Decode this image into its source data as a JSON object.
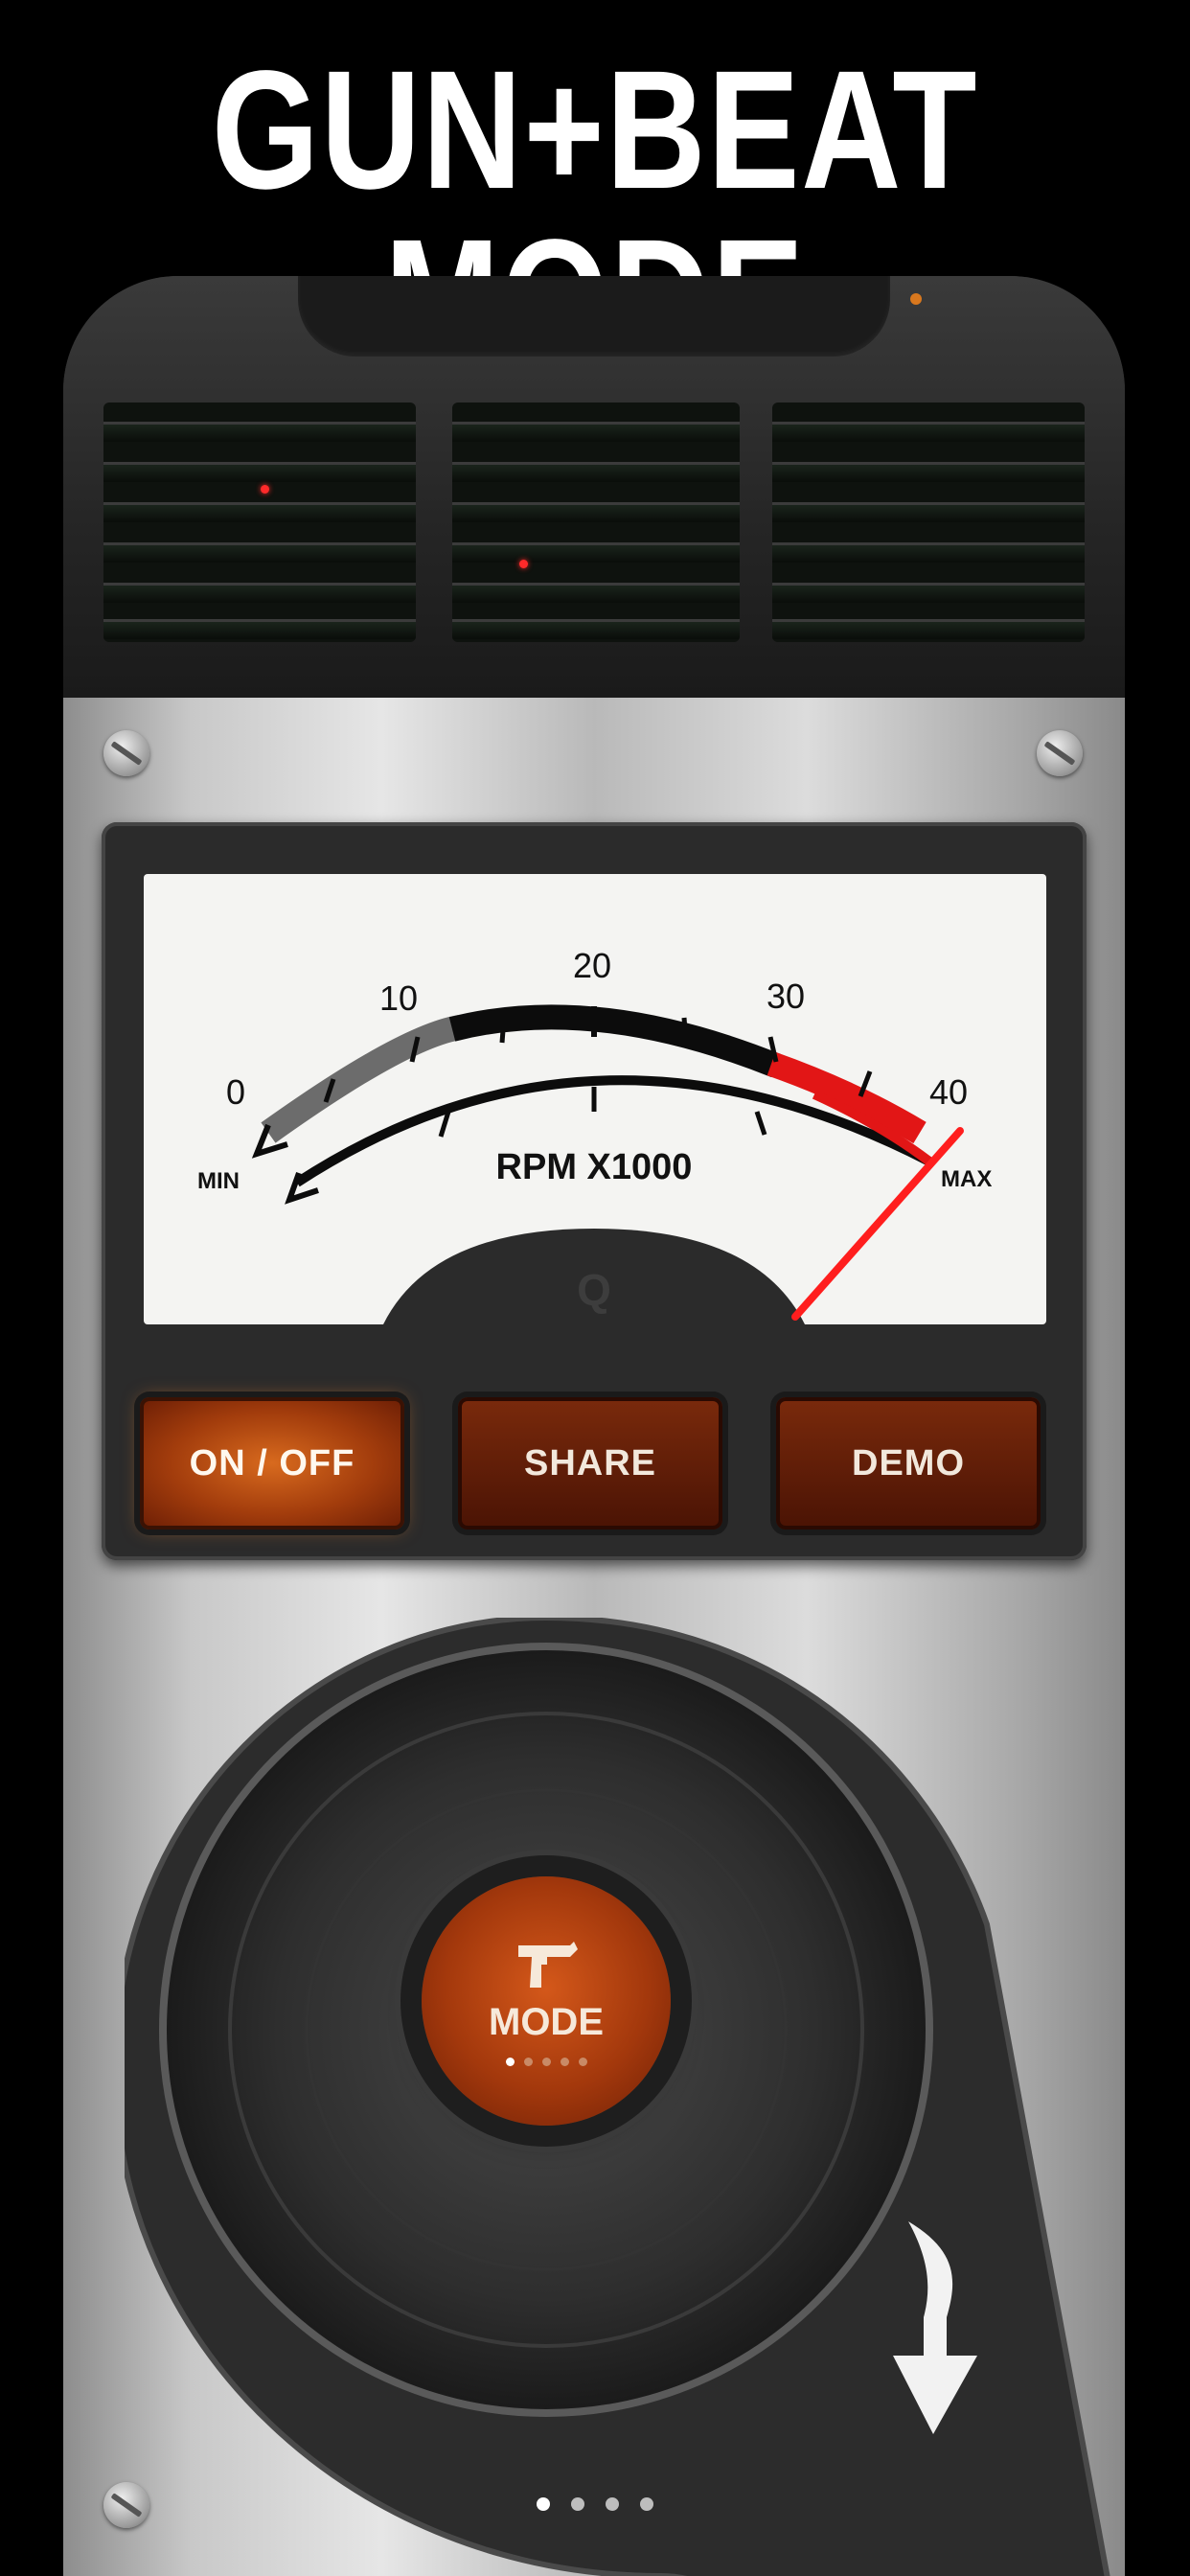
{
  "headline": "GUN+BEAT MODE",
  "meter": {
    "ticks": [
      "0",
      "10",
      "20",
      "30",
      "40"
    ],
    "min_label": "MIN",
    "max_label": "MAX",
    "unit_label": "RPM X1000",
    "brand_mark": "Q"
  },
  "buttons": {
    "on_off": "ON / OFF",
    "share": "SHARE",
    "demo": "DEMO"
  },
  "mode": {
    "label": "MODE",
    "icon": "gun-icon",
    "dots_total": 5,
    "dots_active_index": 0
  },
  "pager": {
    "dots_total": 4,
    "active_index": 0
  },
  "colors": {
    "accent_orange": "#d4581a",
    "needle_red": "#ff1e1e",
    "button_brown": "#6a1d05"
  }
}
